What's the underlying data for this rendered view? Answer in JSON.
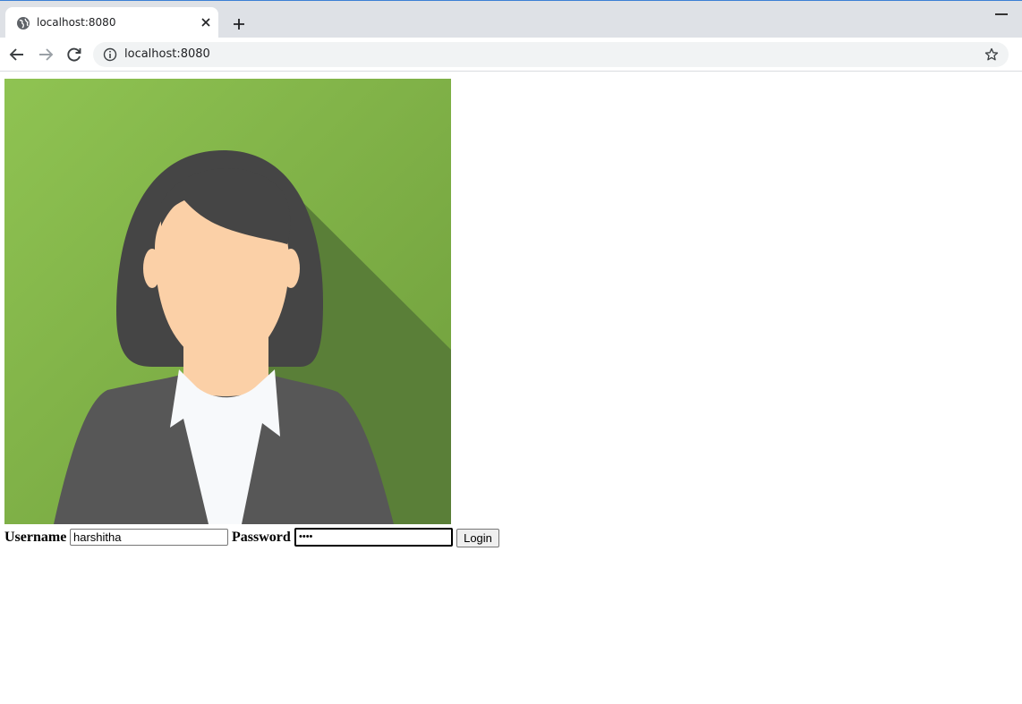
{
  "browser": {
    "tab_title": "localhost:8080",
    "url": "localhost:8080",
    "icons": {
      "favicon": "globe-icon",
      "tab_close": "close-icon",
      "new_tab": "plus-icon",
      "back": "arrow-left-icon",
      "forward": "arrow-right-icon",
      "reload": "reload-icon",
      "site_info": "info-icon",
      "bookmark": "star-icon",
      "minimize": "minimize-icon"
    }
  },
  "page": {
    "avatar": {
      "description_name": "woman-avatar-image",
      "background_color": "#8bc34a",
      "shadow_color": "#5a7f38"
    },
    "login": {
      "username_label": "Username",
      "username_value": "harshitha",
      "password_label": "Password",
      "password_value": "••••",
      "button_label": "Login"
    }
  },
  "colors": {
    "tabstrip": "#dee1e6",
    "omnibox": "#f1f3f4"
  }
}
